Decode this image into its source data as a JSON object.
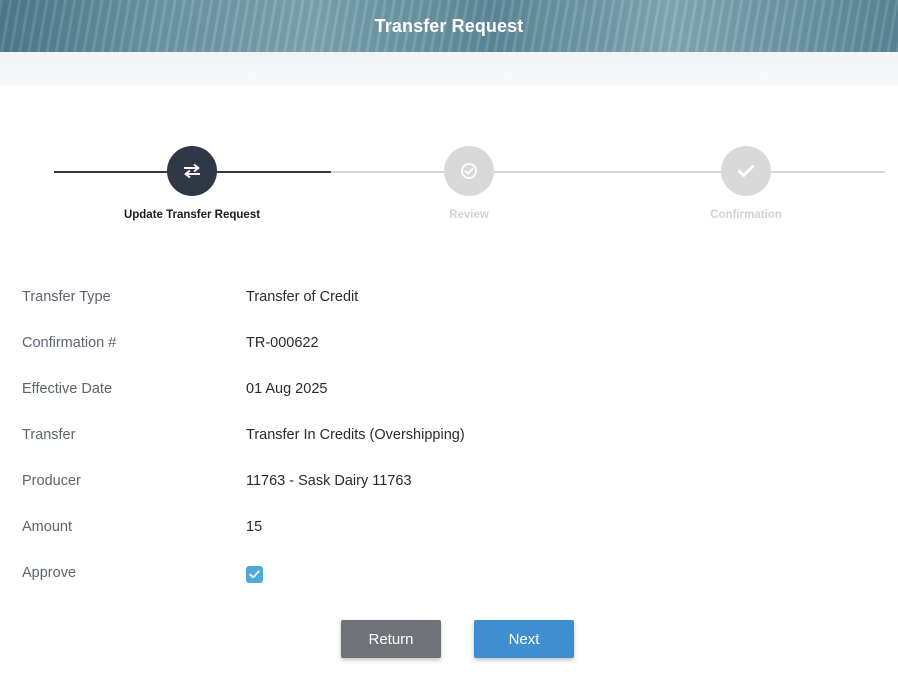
{
  "header": {
    "title": "Transfer Request"
  },
  "stepper": {
    "steps": [
      {
        "label": "Update Transfer Request",
        "state": "active",
        "icon": "transfer-arrows-icon"
      },
      {
        "label": "Review",
        "state": "inactive",
        "icon": "check-circle-icon"
      },
      {
        "label": "Confirmation",
        "state": "inactive",
        "icon": "checkmark-icon"
      }
    ]
  },
  "fields": [
    {
      "label": "Transfer Type",
      "value": "Transfer of Credit"
    },
    {
      "label": "Confirmation #",
      "value": "TR-000622"
    },
    {
      "label": "Effective Date",
      "value": "01 Aug 2025"
    },
    {
      "label": "Transfer",
      "value": "Transfer In Credits (Overshipping)"
    },
    {
      "label": "Producer",
      "value": "11763 - Sask Dairy 11763"
    },
    {
      "label": "Amount",
      "value": "15"
    },
    {
      "label": "Approve",
      "checked": true
    }
  ],
  "buttons": {
    "return_label": "Return",
    "next_label": "Next"
  },
  "colors": {
    "accent": "#3f8fd0",
    "step_active": "#2e3846",
    "checkbox": "#4fa9d9"
  }
}
